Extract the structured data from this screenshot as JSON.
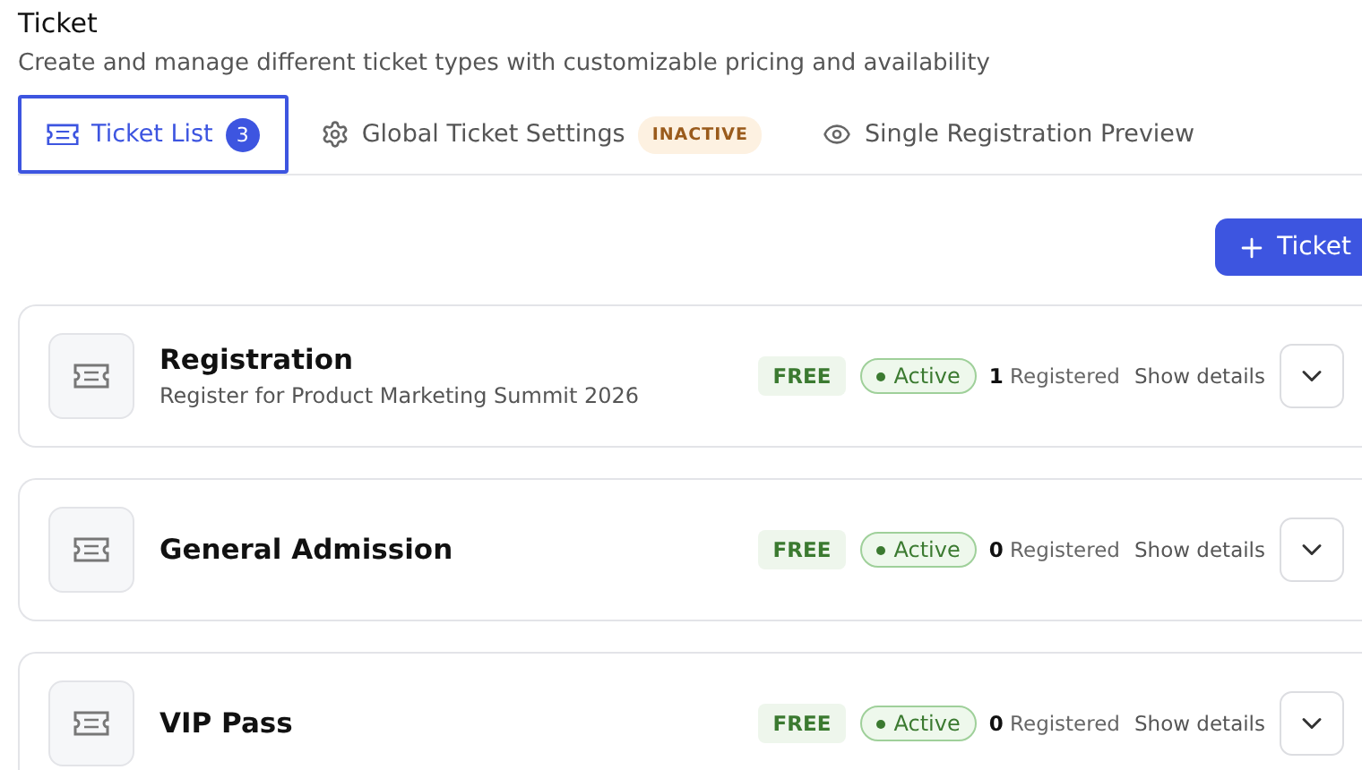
{
  "header": {
    "title": "Ticket",
    "subtitle": "Create and manage different ticket types with customizable pricing and availability"
  },
  "tabs": [
    {
      "label": "Ticket List",
      "kind": "list",
      "count": "3",
      "selected": true
    },
    {
      "label": "Global Ticket Settings",
      "kind": "settings",
      "badge": "INACTIVE",
      "selected": false
    },
    {
      "label": "Single Registration Preview",
      "kind": "preview",
      "selected": false
    }
  ],
  "add_button": {
    "label": "Ticket"
  },
  "tickets": [
    {
      "name": "Registration",
      "description": "Register for Product Marketing Summit 2026",
      "price": "FREE",
      "status": "Active",
      "count": "1",
      "count_label": "Registered",
      "details": "Show details"
    },
    {
      "name": "General Admission",
      "price": "FREE",
      "status": "Active",
      "count": "0",
      "count_label": "Registered",
      "details": "Show details"
    },
    {
      "name": "VIP Pass",
      "price": "FREE",
      "status": "Active",
      "count": "0",
      "count_label": "Registered",
      "details": "Show details"
    }
  ]
}
